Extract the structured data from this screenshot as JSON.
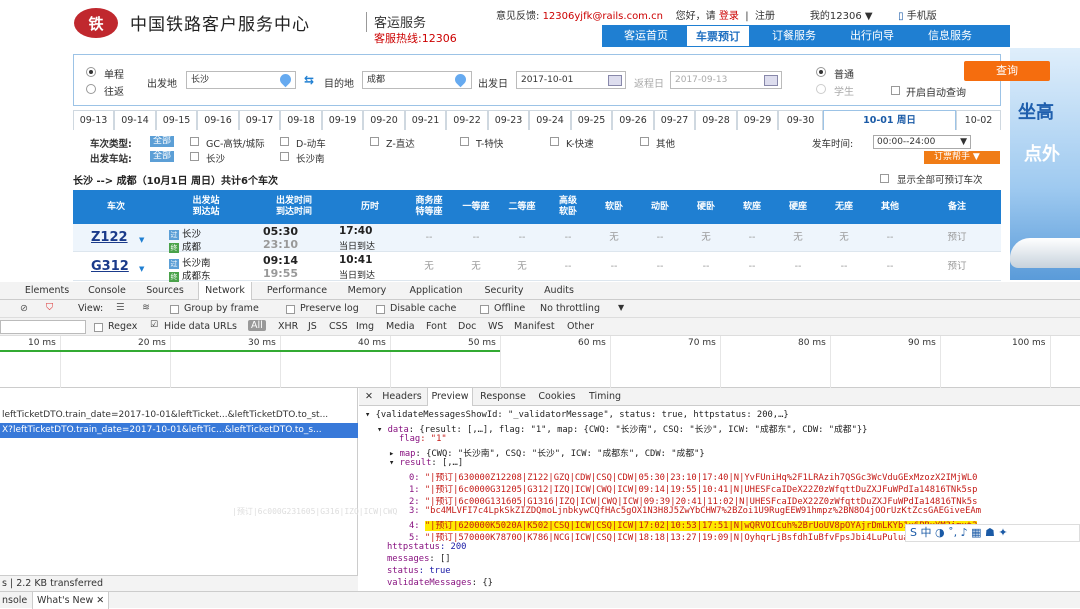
{
  "header": {
    "logo_glyph": "铁",
    "site_title": "中国铁路客户服务中心",
    "site_sub": "客运服务",
    "hotline": "客服热线:12306",
    "feedback_label": "意见反馈:",
    "feedback_email": "12306yjfk@rails.com.cn",
    "greeting": "您好，请",
    "login": "登录",
    "sep": "|",
    "register": "注册",
    "my12306": "我的12306",
    "mobile": "手机版",
    "nav": [
      "客运首页",
      "车票预订",
      "订餐服务",
      "出行向导",
      "信息服务"
    ]
  },
  "ad": {
    "t1": "坐高",
    "t2": "点外"
  },
  "search": {
    "oneway": "单程",
    "roundtrip": "往返",
    "from_label": "出发地",
    "from_value": "长沙",
    "to_label": "目的地",
    "to_value": "成都",
    "date_label": "出发日",
    "date_value": "2017-10-01",
    "return_label": "返程日",
    "return_value": "2017-09-13",
    "normal": "普通",
    "student": "学生",
    "query": "查询",
    "auto_query": "开启自动查询"
  },
  "dates": [
    "09-13",
    "09-14",
    "09-15",
    "09-16",
    "09-17",
    "09-18",
    "09-19",
    "09-20",
    "09-21",
    "09-22",
    "09-23",
    "09-24",
    "09-25",
    "09-26",
    "09-27",
    "09-28",
    "09-29",
    "09-30",
    "10-01 周日",
    "10-02"
  ],
  "filters": {
    "type_label": "车次类型:",
    "all": "全部",
    "types": [
      "GC-高铁/城际",
      "D-动车",
      "Z-直达",
      "T-特快",
      "K-快速",
      "其他"
    ],
    "station_label": "出发车站:",
    "stations": [
      "长沙",
      "长沙南"
    ],
    "time_label": "发车时间:",
    "time_value": "00:00--24:00",
    "helper": "订票帮手"
  },
  "route": {
    "text": "长沙 --> 成都（10月1日  周日）共计6个车次",
    "show_all": "显示全部可预订车次"
  },
  "table": {
    "headers": [
      "车次",
      "出发站\n到达站",
      "出发时间\n到达时间",
      "历时",
      "商务座\n特等座",
      "一等座",
      "二等座",
      "高级\n软卧",
      "软卧",
      "动卧",
      "硬卧",
      "软座",
      "硬座",
      "无座",
      "其他",
      "备注"
    ],
    "rows": [
      {
        "no": "Z122",
        "from_tag": "过",
        "from": "长沙",
        "to_tag": "终",
        "to": "成都",
        "dep": "05:30",
        "arr": "23:10",
        "dur": "17:40",
        "day": "当日到达",
        "seats": [
          "--",
          "--",
          "--",
          "--",
          "无",
          "--",
          "无",
          "--",
          "无",
          "无",
          "--"
        ],
        "note": "预订"
      },
      {
        "no": "G312",
        "from_tag": "过",
        "from": "长沙南",
        "to_tag": "终",
        "to": "成都东",
        "dep": "09:14",
        "arr": "19:55",
        "dur": "10:41",
        "day": "当日到达",
        "seats": [
          "无",
          "无",
          "无",
          "--",
          "--",
          "--",
          "--",
          "--",
          "--",
          "--",
          "--"
        ],
        "note": "预订"
      }
    ]
  },
  "devtools": {
    "tabs": [
      "Elements",
      "Console",
      "Sources",
      "Network",
      "Performance",
      "Memory",
      "Application",
      "Security",
      "Audits"
    ],
    "view_label": "View:",
    "group_by_frame": "Group by frame",
    "preserve_log": "Preserve log",
    "disable_cache": "Disable cache",
    "offline": "Offline",
    "throttling": "No throttling",
    "regex": "Regex",
    "hide_data_urls": "Hide data URLs",
    "filter_types": [
      "All",
      "XHR",
      "JS",
      "CSS",
      "Img",
      "Media",
      "Font",
      "Doc",
      "WS",
      "Manifest",
      "Other"
    ],
    "timeline_ticks": [
      "10 ms",
      "20 ms",
      "30 ms",
      "40 ms",
      "50 ms",
      "60 ms",
      "70 ms",
      "80 ms",
      "90 ms",
      "100 ms"
    ],
    "requests": [
      "leftTicketDTO.train_date=2017-10-01&leftTicket...&leftTicketDTO.to_st...",
      "X?leftTicketDTO.train_date=2017-10-01&leftTic...&leftTicketDTO.to_s..."
    ],
    "panel_tabs": [
      "Headers",
      "Preview",
      "Response",
      "Cookies",
      "Timing"
    ],
    "status": "s | 2.2 KB transferred",
    "drawer_tabs": [
      "nsole",
      "What's New"
    ]
  },
  "json_preview": {
    "l0": "{validateMessagesShowId: \"_validatorMessage\", status: true, httpstatus: 200,…}",
    "l1a": "data",
    "l1b": ": {result: [,…], flag: \"1\", map: {CWQ: \"长沙南\", CSQ: \"长沙\", ICW: \"成都东\", CDW: \"成都\"}}",
    "l2a": "flag",
    "l2b": ": \"1\"",
    "l3a": "map",
    "l3b": ": {CWQ: \"长沙南\", CSQ: \"长沙\", ICW: \"成都东\", CDW: \"成都\"}",
    "l4a": "result",
    "l4b": ": [,…]",
    "r0": "\"|预订|630000Z12208|Z122|GZQ|CDW|CSQ|CDW|05:30|23:10|17:40|N|YvFUniHq%2F1LRAzih7QSGc3WcVduGExMzozX2IMjWL0",
    "r1": "\"|预订|6c0000G31205|G312|IZQ|ICW|CWQ|ICW|09:14|19:55|10:41|N|UHESFcaIDeX22Z0zWfqttDuZXJFuWPdIa14816TNk5sp",
    "r2": "\"|预订|6c000G131605|G1316|IZQ|ICW|CWQ|ICW|09:39|20:41|11:02|N|UHESFcaIDeX22Z0zWfqttDuZXJFuWPdIa14816TNk5s",
    "r3": "\"bc4MLVFI7c4LpkSkZIZDQmoLjnbkywCQfHAc5gOX1N3H8J5ZwYbCHW7%2BZoi1U9RugEEW91hmpz%2BN8O4jOOrUzKtZcsGAEGiveEAm",
    "r4": "\"|预订|620000K5020A|K502|CSQ|ICW|CSQ|ICW|17:02|10:53|17:51|N|wQRVOICuh%2BrUoUV8pOYAjrDmLKYb1x6PBuYM3imxt2",
    "r5": "\"|预订|570000K7870O|K786|NCG|ICW|CSQ|ICW|18:18|13:27|19:09|N|OyhqrLjBsfdhIuBfvFpsJbi4LuPuluaAVX9LOUhRD%2F",
    "r_idx": [
      "0:",
      "1:",
      "2:",
      "3:",
      "4:",
      "5:"
    ],
    "ghost": "|预订|6c000G231605|G316|IZQ|ICW|CWQ",
    "httpstatus": "httpstatus",
    "httpstatus_v": ": 200",
    "messages": "messages",
    "messages_v": ": []",
    "status": "status",
    "status_v": ": true",
    "vms": "validateMessages",
    "vms_v": ": {}",
    "vmsid": "validateMessagesShowId",
    "vmsid_v": ": \"_validatorMessage\""
  },
  "ime": {
    "text": "S 中 ◑ ˚, ♪ ▦ ☗ ✦"
  }
}
